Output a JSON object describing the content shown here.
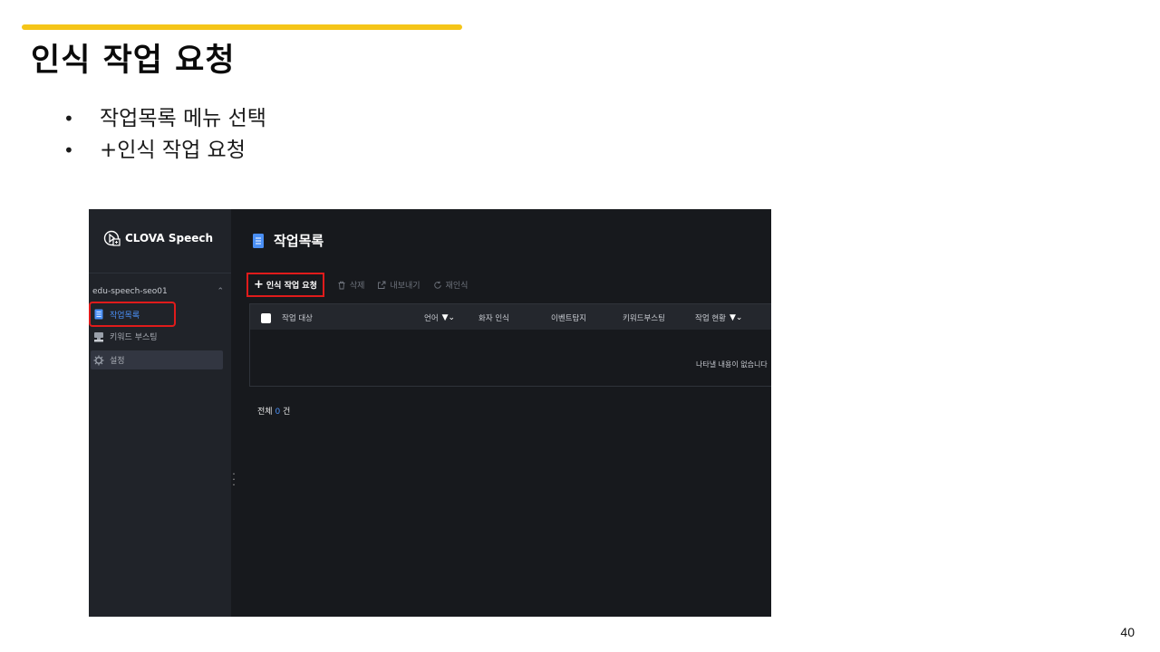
{
  "slide": {
    "title": "인식 작업 요청",
    "bullets": [
      "작업목록 메뉴 선택",
      "+인식 작업 요청"
    ],
    "bullet_symbol": "•",
    "page_number": "40",
    "accent_color": "#f5c518"
  },
  "app": {
    "brand": "CLOVA Speech",
    "project": "edu-speech-seo01",
    "nav": [
      {
        "label": "작업목록",
        "icon": "list-doc-icon",
        "active": true
      },
      {
        "label": "키워드 부스팅",
        "icon": "keyword-icon",
        "active": false
      },
      {
        "label": "설정",
        "icon": "gear-icon",
        "active": false
      }
    ],
    "page_title": "작업목록",
    "toolbar": {
      "request": "인식 작업 요청",
      "delete": "삭제",
      "export": "내보내기",
      "reprocess": "재인식"
    },
    "columns": [
      "작업 대상",
      "언어",
      "화자 인식",
      "이벤트탐지",
      "키워드부스팅",
      "작업 현황"
    ],
    "empty_message": "나타낼 내용이 없습니다",
    "total": {
      "prefix": "전체",
      "count": "0",
      "suffix": "건"
    },
    "highlight_color": "#e01b1b",
    "link_color": "#4a8ff5"
  }
}
